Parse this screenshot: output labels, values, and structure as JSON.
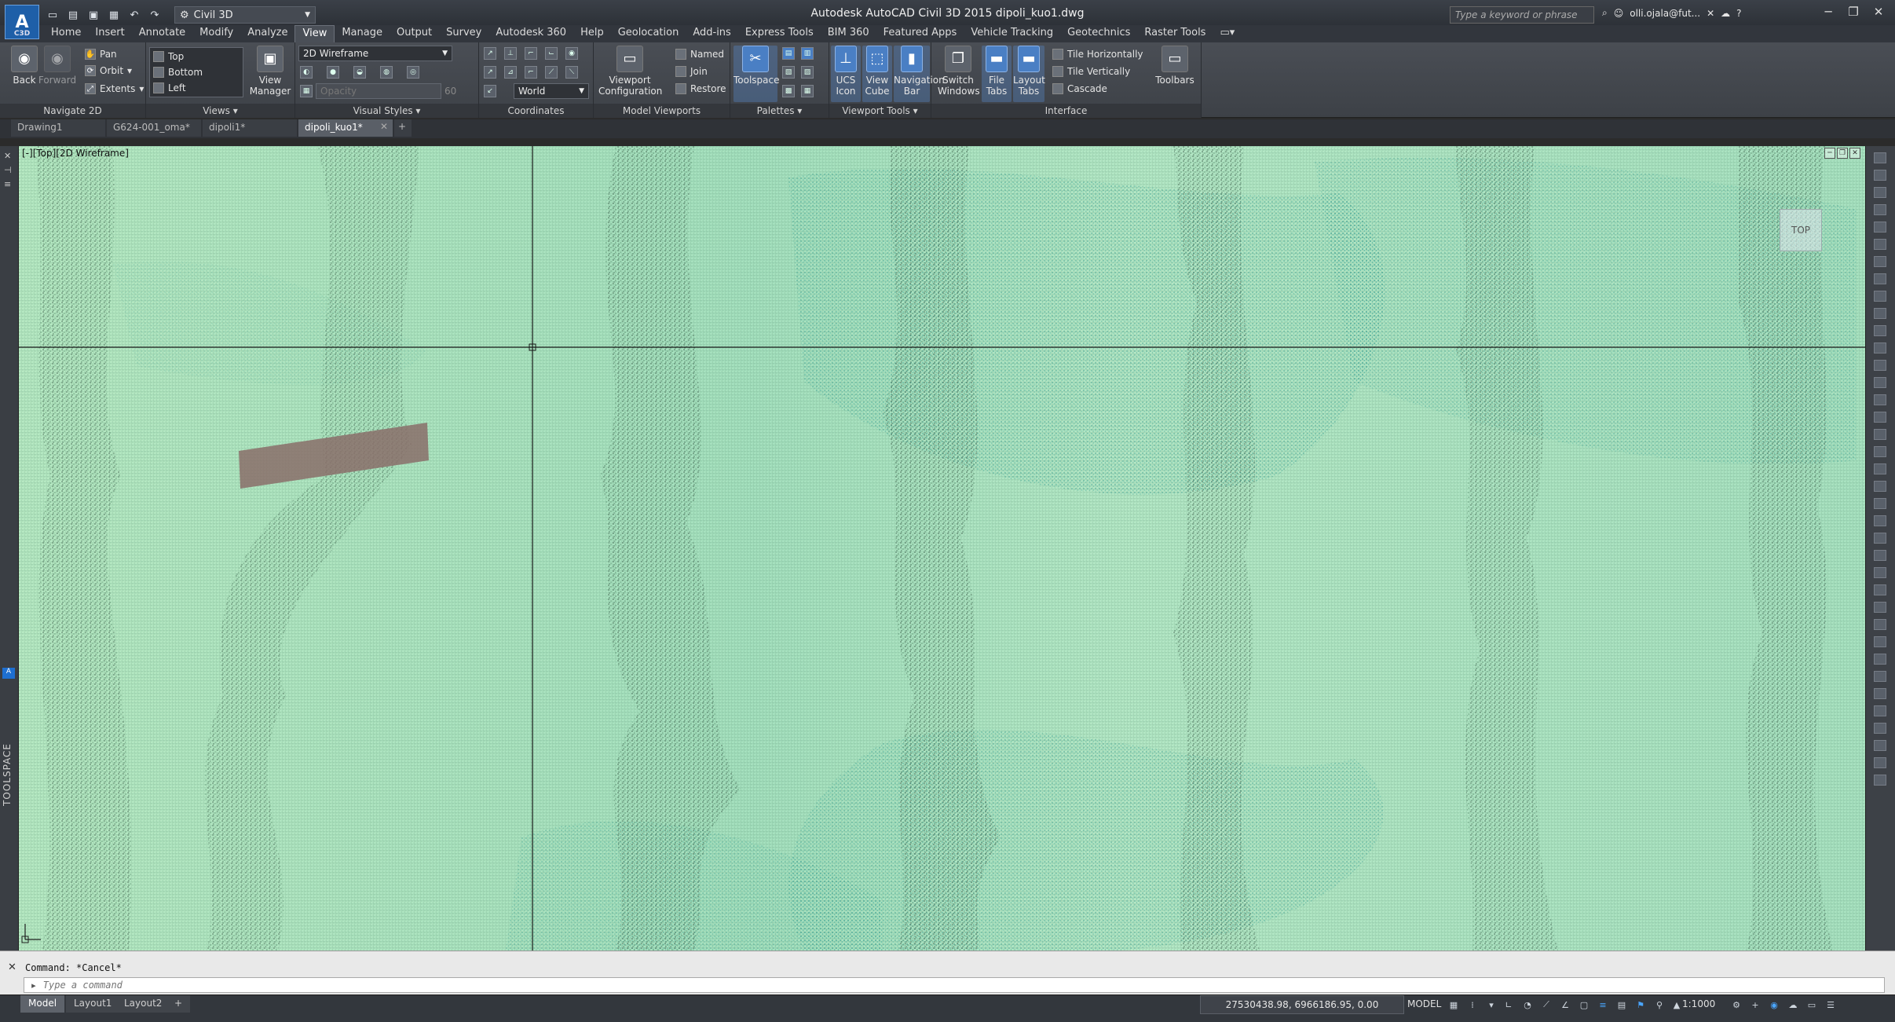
{
  "window": {
    "title": "Autodesk AutoCAD Civil 3D 2015    dipoli_kuo1.dwg",
    "workspace": "Civil 3D",
    "search_placeholder": "Type a keyword or phrase",
    "user": "olli.ojala@fut...",
    "logo_sub": "C3D"
  },
  "ribbon_tabs": [
    "Home",
    "Insert",
    "Annotate",
    "Modify",
    "Analyze",
    "View",
    "Manage",
    "Output",
    "Survey",
    "Autodesk 360",
    "Help",
    "Geolocation",
    "Add-ins",
    "Express Tools",
    "BIM 360",
    "Featured Apps",
    "Vehicle Tracking",
    "Geotechnics",
    "Raster Tools"
  ],
  "panels": {
    "navigate": {
      "title": "Navigate 2D",
      "back": "Back",
      "forward": "Forward",
      "pan": "Pan",
      "orbit": "Orbit",
      "extents": "Extents"
    },
    "views": {
      "title": "Views",
      "items": [
        "Top",
        "Bottom",
        "Left"
      ],
      "view_manager": "View\nManager"
    },
    "visual_styles": {
      "title": "Visual Styles",
      "current": "2D Wireframe",
      "opacity_label": "Opacity",
      "opacity_value": "60"
    },
    "coordinates": {
      "title": "Coordinates",
      "ucs": "World"
    },
    "model_viewports": {
      "title": "Model Viewports",
      "config": "Viewport\nConfiguration",
      "named": "Named",
      "join": "Join",
      "restore": "Restore"
    },
    "palettes": {
      "title": "Palettes",
      "toolspace": "Toolspace"
    },
    "viewport_tools": {
      "title": "Viewport Tools",
      "ucs_icon": "UCS\nIcon",
      "view_cube": "View\nCube",
      "nav_bar": "Navigation\nBar"
    },
    "interface": {
      "title": "Interface",
      "switch_windows": "Switch\nWindows",
      "file_tabs": "File\nTabs",
      "layout_tabs": "Layout\nTabs",
      "tile_h": "Tile Horizontally",
      "tile_v": "Tile Vertically",
      "cascade": "Cascade",
      "toolbars": "Toolbars"
    }
  },
  "file_tabs": [
    {
      "label": "Drawing1",
      "active": false
    },
    {
      "label": "G624-001_oma*",
      "active": false
    },
    {
      "label": "dipoli1*",
      "active": false
    },
    {
      "label": "dipoli_kuo1*",
      "active": true
    }
  ],
  "viewport": {
    "label": "[-][Top][2D Wireframe]",
    "viewcube": "TOP"
  },
  "toolspace_label": "TOOLSPACE",
  "command": {
    "history": "Command: *Cancel*",
    "placeholder": "Type a command"
  },
  "layout_tabs": [
    "Model",
    "Layout1",
    "Layout2"
  ],
  "status": {
    "coords": "27530438.98, 6966186.95, 0.00",
    "space": "MODEL",
    "scale": "1:1000"
  },
  "colors": {
    "point_cloud_light": "#b5e7c6",
    "point_cloud_dark": "#1f3b2a",
    "point_cloud_teal": "#2fa39a"
  }
}
